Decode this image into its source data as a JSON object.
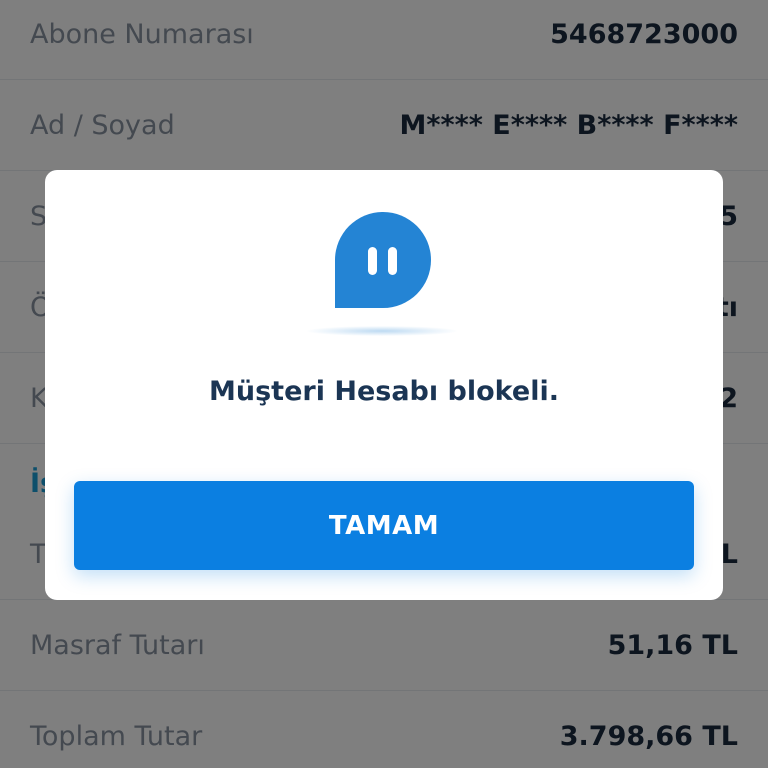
{
  "colors": {
    "primary": "#0b7fe1",
    "section_heading": "#1a9fd6",
    "label": "#8893a0",
    "value": "#1b2b3f",
    "message": "#1b3554"
  },
  "details": {
    "rows": [
      {
        "label": "Abone Numarası",
        "value": "5468723000"
      },
      {
        "label": "Ad / Soyad",
        "value": "M**** E**** B**** F****"
      },
      {
        "label": "S",
        "value": "5"
      },
      {
        "label": "Ö",
        "value": "tı"
      },
      {
        "label": "K",
        "value": "2"
      },
      {
        "label": "T",
        "value": "L"
      },
      {
        "label": "Masraf Tutarı",
        "value": "51,16 TL"
      },
      {
        "label": "Toplam Tutar",
        "value": "3.798,66 TL"
      }
    ],
    "section_heading": "İş"
  },
  "dialog": {
    "icon": "pause-chat-bubble-icon",
    "message": "Müşteri Hesabı blokeli.",
    "ok_label": "TAMAM"
  }
}
